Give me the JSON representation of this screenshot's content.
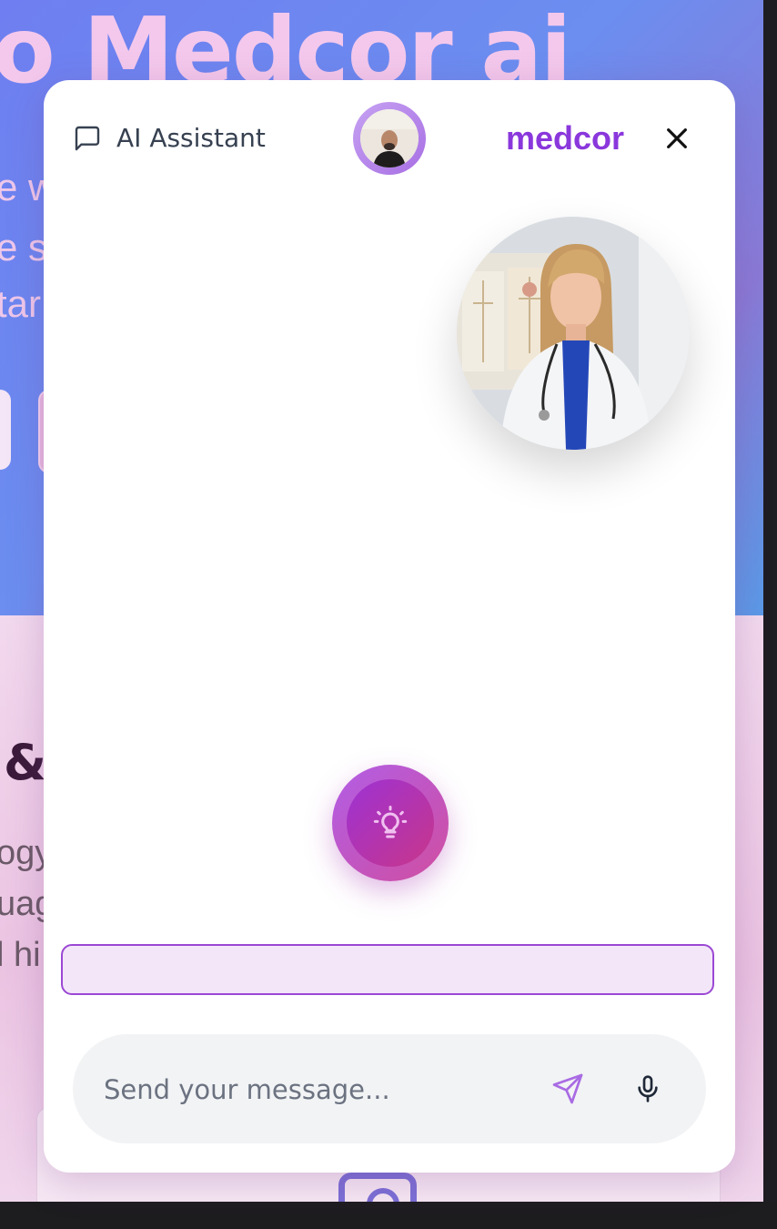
{
  "background_page": {
    "hero_title": "o Medcor ai",
    "hero_lines": [
      "e w",
      "e su",
      "tar"
    ],
    "section_title": "&",
    "section_lines": [
      "ogy",
      "uag",
      "l hi"
    ]
  },
  "widget": {
    "header": {
      "chat_icon": "message-square-icon",
      "title": "AI Assistant",
      "brand": "medcor",
      "close_icon": "close-icon"
    },
    "user_avatar": "user-webcam-avatar",
    "doctor_avatar": "doctor-avatar",
    "idea_button_icon": "lightbulb-icon",
    "composer": {
      "placeholder": "Send your message...",
      "send_icon": "send-icon",
      "mic_icon": "microphone-icon"
    }
  },
  "colors": {
    "brand": "#8a37dc",
    "accent_gradient_start": "#b25ee6",
    "accent_gradient_end": "#d04ea0",
    "transcript_border": "#9b48d4",
    "transcript_fill": "#f3e6f9"
  }
}
